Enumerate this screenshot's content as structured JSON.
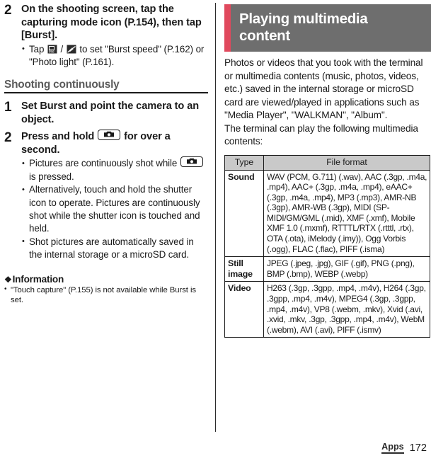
{
  "left_column": {
    "step_2a": {
      "number": "2",
      "title": "On the shooting screen, tap the capturing mode icon (P.154), then tap [Burst].",
      "bullets_prefix": "Tap ",
      "bullets_mid": " / ",
      "bullets_suffix": " to set \"Burst speed\" (P.162) or \"Photo light\" (P.161).",
      "icon_burst_speed_label": "burst-speed-mid-icon",
      "icon_photo_light_label": "photo-light-off-icon"
    },
    "section_heading": "Shooting continuously",
    "step_1": {
      "number": "1",
      "title": "Set Burst and point the camera to an object."
    },
    "step_2b": {
      "number": "2",
      "title_before_key": "Press and hold ",
      "title_after_key": " for over a second.",
      "key_icon_label": "camera-key-icon",
      "bullet_1_before_key": "Pictures are continuously shot while ",
      "bullet_1_after_key": " is pressed.",
      "bullet_2": "Alternatively, touch and hold the shutter icon to operate. Pictures are continuously shot while the shutter icon is touched and held.",
      "bullet_3": "Shot pictures are automatically saved in the internal storage or a microSD card."
    },
    "information": {
      "marker": "❖",
      "heading": "Information",
      "items": [
        "\"Touch capture\" (P.155) is not available while Burst is set."
      ]
    }
  },
  "right_column": {
    "banner": {
      "title": "Playing multimedia content",
      "accent_color": "#e0495d",
      "background_color": "#6e6e6e"
    },
    "intro_paragraphs": [
      "Photos or videos that you took with the terminal or multimedia contents (music, photos, videos, etc.) saved in the internal storage or microSD card are viewed/played in applications such as \"Media Player\", \"WALKMAN\", \"Album\".",
      "The terminal can play the following multimedia contents:"
    ],
    "table": {
      "headers": [
        "Type",
        "File format"
      ],
      "header_background": "#c9c9c9",
      "rows": [
        {
          "type": "Sound",
          "format": "WAV (PCM, G.711) (.wav), AAC (.3gp, .m4a, .mp4), AAC+ (.3gp, .m4a, .mp4), eAAC+ (.3gp, .m4a, .mp4), MP3 (.mp3), AMR-NB (.3gp), AMR-WB (.3gp), MIDI (SP-MIDI/GM/GML (.mid), XMF (.xmf), Mobile XMF 1.0 (.mxmf), RTTTL/RTX (.rtttl, .rtx), OTA (.ota), iMelody (.imy)), Ogg Vorbis (.ogg), FLAC (.flac), PIFF (.isma)"
        },
        {
          "type": "Still image",
          "format": "JPEG (.jpeg, .jpg), GIF (.gif), PNG (.png), BMP (.bmp), WEBP (.webp)"
        },
        {
          "type": "Video",
          "format": "H263 (.3gp, .3gpp, .mp4, .m4v), H264 (.3gp, .3gpp, .mp4, .m4v), MPEG4 (.3gp, .3gpp, .mp4, .m4v), VP8 (.webm, .mkv), Xvid (.avi, .xvid, .mkv, .3gp, .3gpp, .mp4, .m4v), WebM (.webm), AVI (.avi), PIFF (.ismv)"
        }
      ]
    }
  },
  "footer": {
    "tab_label": "Apps",
    "page_number": "172"
  }
}
